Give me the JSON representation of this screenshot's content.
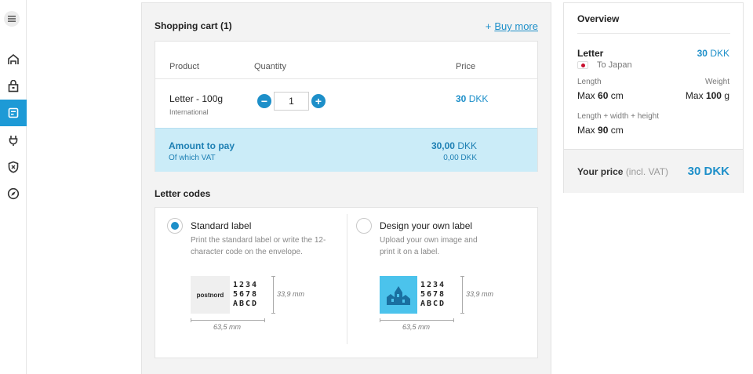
{
  "colors": {
    "accent": "#1d8fc9",
    "active_nav": "#1d9ad6",
    "highlight_row": "#cbecf8"
  },
  "sidebar": {
    "items": [
      {
        "icon": "menu-icon"
      },
      {
        "icon": "mailbox-icon"
      },
      {
        "icon": "parcel-icon"
      },
      {
        "icon": "letter-label-icon",
        "active": true
      },
      {
        "icon": "plug-icon"
      },
      {
        "icon": "shield-icon"
      },
      {
        "icon": "compass-icon"
      }
    ]
  },
  "cart": {
    "title": "Shopping cart (1)",
    "buy_more_plus": "+",
    "buy_more": "Buy more",
    "columns": {
      "product": "Product",
      "quantity": "Quantity",
      "price": "Price"
    },
    "item": {
      "name": "Letter - 100g",
      "sub": "International",
      "quantity": "1",
      "minus": "−",
      "plus": "+",
      "price_value": "30",
      "price_currency": "DKK"
    },
    "amount_label": "Amount to pay",
    "vat_label": "Of which VAT",
    "amount_value": "30,00",
    "amount_currency": "DKK",
    "vat_value": "0,00 DKK"
  },
  "codes": {
    "title": "Letter codes",
    "options": [
      {
        "title": "Standard label",
        "desc": "Print the standard label or write the 12-character code on the envelope.",
        "checked": true,
        "logo": "postnord",
        "code_lines": [
          "1234",
          "5678",
          "ABCD"
        ],
        "height": "33,9 mm",
        "width": "63,5 mm"
      },
      {
        "title": "Design your own label",
        "desc": "Upload your own image and print it on a label.",
        "checked": false,
        "code_lines": [
          "1234",
          "5678",
          "ABCD"
        ],
        "height": "33,9 mm",
        "width": "63,5 mm"
      }
    ]
  },
  "overview": {
    "title": "Overview",
    "item": "Letter",
    "item_price_value": "30",
    "item_price_currency": "DKK",
    "destination": "To Japan",
    "length_label": "Length",
    "length_prefix": "Max",
    "length_value": "60",
    "length_unit": "cm",
    "weight_label": "Weight",
    "weight_prefix": "Max",
    "weight_value": "100",
    "weight_unit": "g",
    "lwh_label": "Length + width + height",
    "lwh_prefix": "Max",
    "lwh_value": "90",
    "lwh_unit": "cm",
    "total_label": "Your price",
    "total_label_suffix": "(incl. VAT)",
    "total_price": "30 DKK"
  }
}
